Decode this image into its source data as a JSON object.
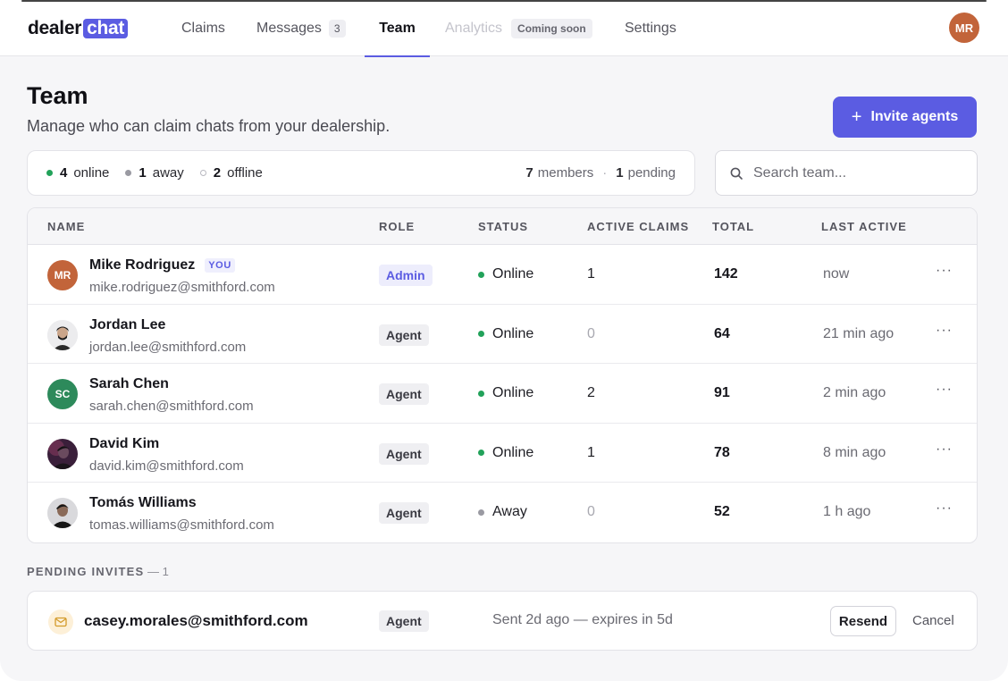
{
  "brand": {
    "word1": "dealer",
    "word2": "chat",
    "accent": "#5b5ce2"
  },
  "nav": {
    "claims": "Claims",
    "messages": "Messages",
    "messages_count": "3",
    "team": "Team",
    "analytics": "Analytics",
    "analytics_badge": "Coming soon",
    "settings": "Settings",
    "user_initials": "MR"
  },
  "page": {
    "title": "Team",
    "subtitle": "Manage who can claim chats from your dealership.",
    "invite_button": "Invite agents",
    "invite_icon": "+"
  },
  "stats": {
    "online_count": "4",
    "online_label": "online",
    "away_count": "1",
    "away_label": "away",
    "offline_count": "2",
    "offline_label": "offline",
    "members_count": "7",
    "members_label": "members",
    "separator": "·",
    "pending_count": "1",
    "pending_label": "pending"
  },
  "search": {
    "placeholder": "Search team..."
  },
  "table": {
    "headers": [
      "NAME",
      "ROLE",
      "STATUS",
      "ACTIVE CLAIMS",
      "TOTAL",
      "LAST ACTIVE"
    ],
    "rows": [
      {
        "initials": "MR",
        "name": "Mike Rodriguez",
        "you": "YOU",
        "email": "mike.rodriguez@smithford.com",
        "role": "Admin",
        "status": "Online",
        "claims": "1",
        "total": "142",
        "last": "now",
        "more": "···"
      },
      {
        "initials": "",
        "name": "Jordan Lee",
        "email": "jordan.lee@smithford.com",
        "role": "Agent",
        "status": "Online",
        "claims": "0",
        "total": "64",
        "last": "21 min ago",
        "more": "···"
      },
      {
        "initials": "SC",
        "name": "Sarah Chen",
        "email": "sarah.chen@smithford.com",
        "role": "Agent",
        "status": "Online",
        "claims": "2",
        "total": "91",
        "last": "2 min ago",
        "more": "···"
      },
      {
        "initials": "",
        "name": "David Kim",
        "email": "david.kim@smithford.com",
        "role": "Agent",
        "status": "Online",
        "claims": "1",
        "total": "78",
        "last": "8 min ago",
        "more": "···"
      },
      {
        "initials": "",
        "name": "Tomás Williams",
        "email": "tomas.williams@smithford.com",
        "role": "Agent",
        "status": "Away",
        "claims": "0",
        "total": "52",
        "last": "1 h ago",
        "more": "···"
      }
    ],
    "status_colors": {
      "online": "#22a25a",
      "away": "#9a9aa2"
    }
  },
  "pending": {
    "label": "PENDING INVITES",
    "count": "— 1",
    "email": "casey.morales@smithford.com",
    "role": "Agent",
    "sent": "Sent 2d ago — expires in 5d",
    "resend": "Resend",
    "cancel": "Cancel",
    "icon": "mail-icon"
  }
}
